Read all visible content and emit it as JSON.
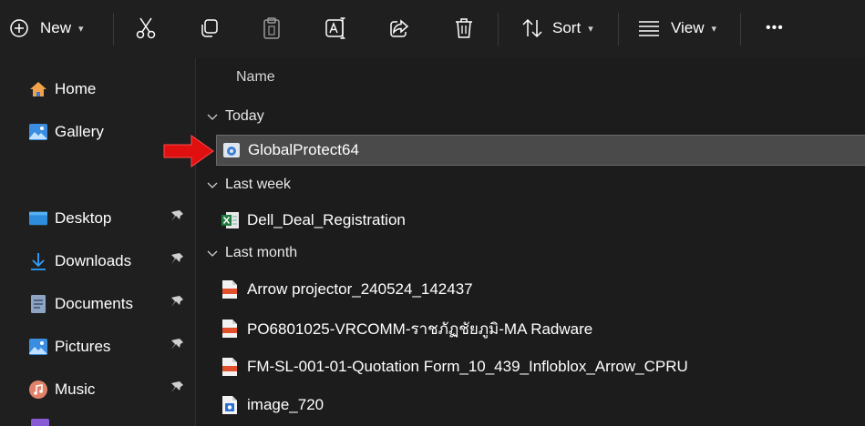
{
  "toolbar": {
    "new_label": "New",
    "sort_label": "Sort",
    "view_label": "View",
    "more_label": "•••"
  },
  "sidebar": {
    "items": [
      {
        "label": "Home",
        "icon": "home-icon"
      },
      {
        "label": "Gallery",
        "icon": "gallery-icon"
      },
      {
        "label": "Desktop",
        "icon": "desktop-icon",
        "pinned": true
      },
      {
        "label": "Downloads",
        "icon": "downloads-icon",
        "pinned": true
      },
      {
        "label": "Documents",
        "icon": "documents-icon",
        "pinned": true
      },
      {
        "label": "Pictures",
        "icon": "pictures-icon",
        "pinned": true
      },
      {
        "label": "Music",
        "icon": "music-icon",
        "pinned": true
      }
    ]
  },
  "main": {
    "column_header": "Name",
    "groups": [
      {
        "label": "Today",
        "files": [
          {
            "name": "GlobalProtect64",
            "selected": true
          }
        ]
      },
      {
        "label": "Last week",
        "files": [
          {
            "name": "Dell_Deal_Registration"
          }
        ]
      },
      {
        "label": "Last month",
        "files": [
          {
            "name": "Arrow projector_240524_142437"
          },
          {
            "name": "PO6801025-VRCOMM-ราชภัฏชัยภูมิ-MA Radware"
          },
          {
            "name": "FM-SL-001-01-Quotation Form_10_439_Infloblox_Arrow_CPRU"
          },
          {
            "name": "image_720"
          }
        ]
      }
    ]
  },
  "colors": {
    "background": "#1c1c1c",
    "selection": "#4a4a4a",
    "annotation_arrow": "#e01010"
  }
}
